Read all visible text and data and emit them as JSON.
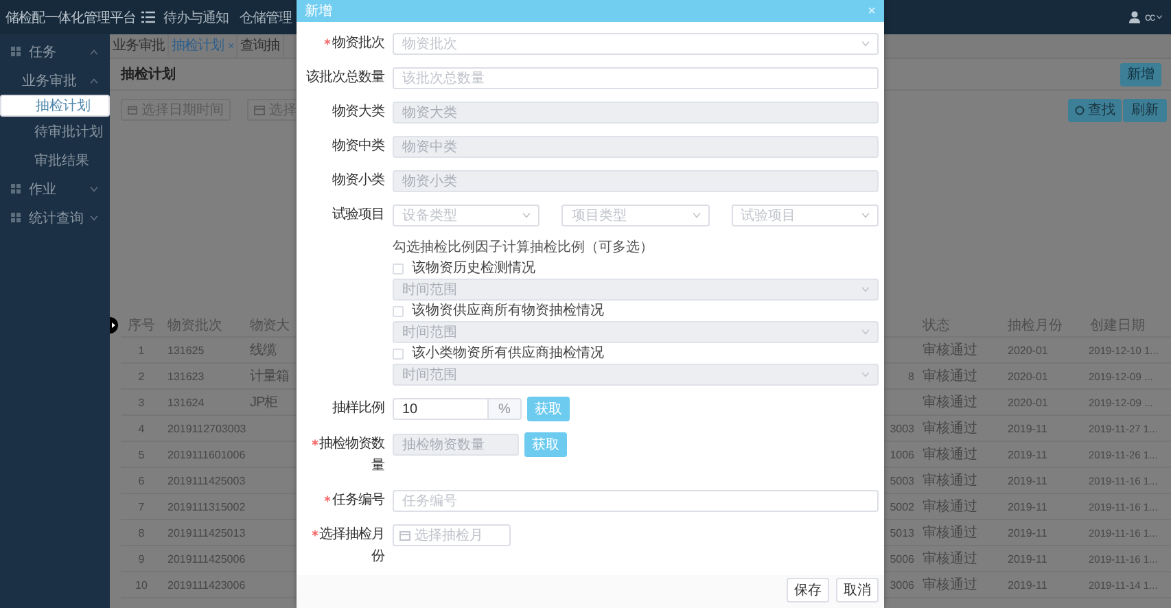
{
  "top_bar": {
    "title": "储检配一体化管理平台",
    "menu": [
      "待办与通知",
      "仓储管理"
    ],
    "user": "cc"
  },
  "sidebar": {
    "items": [
      {
        "label": "任务",
        "expanded": true,
        "children": [
          {
            "label": "业务审批",
            "expanded": true,
            "children": [
              {
                "label": "抽检计划",
                "selected": true
              },
              {
                "label": "待审批计划",
                "selected": false
              },
              {
                "label": "审批结果",
                "selected": false
              }
            ]
          }
        ]
      },
      {
        "label": "作业",
        "expanded": false
      },
      {
        "label": "统计查询",
        "expanded": false
      }
    ]
  },
  "tabs": [
    {
      "label": "业务审批",
      "selected": false
    },
    {
      "label": "抽检计划",
      "selected": true,
      "close": "×"
    },
    {
      "label": "查询抽",
      "selected": false
    }
  ],
  "page": {
    "title": "抽检计划",
    "date_fields": [
      {
        "placeholder": "选择日期时间"
      },
      {
        "placeholder": "选择"
      }
    ],
    "add_button": "新增",
    "search_button": "查找",
    "refresh_button": "刷新"
  },
  "table": {
    "header": {
      "no": "序号",
      "batch": "物资批次",
      "category": "物资大",
      "status": "状态",
      "month": "抽检月份",
      "created": "创建日期"
    },
    "rows": [
      {
        "no": "1",
        "batch": "131625",
        "category": "线缆",
        "status": "审核通过",
        "month": "2020-01",
        "created": "2019-12-10 1..."
      },
      {
        "no": "2",
        "batch": "131623",
        "category": "计量箱",
        "column_4": "8",
        "status": "审核通过",
        "month": "2020-01",
        "created": "2019-12-09 ..."
      },
      {
        "no": "3",
        "batch": "131624",
        "category": "JP柜",
        "status": "审核通过",
        "month": "2020-01",
        "created": "2019-12-09 ..."
      },
      {
        "no": "4",
        "batch": "2019112703003",
        "column_4": "3003",
        "status": "审核通过",
        "month": "2019-11",
        "created": "2019-11-27 1..."
      },
      {
        "no": "5",
        "batch": "2019111601006",
        "column_4": "1006",
        "status": "审核通过",
        "month": "2019-11",
        "created": "2019-11-26 1..."
      },
      {
        "no": "6",
        "batch": "2019111425003",
        "column_4": "5003",
        "status": "审核通过",
        "month": "2019-11",
        "created": "2019-11-16 1..."
      },
      {
        "no": "7",
        "batch": "2019111315002",
        "column_4": "5002",
        "status": "审核通过",
        "month": "2019-11",
        "created": "2019-11-16 1..."
      },
      {
        "no": "8",
        "batch": "2019111425013",
        "column_4": "5013",
        "status": "审核通过",
        "month": "2019-11",
        "created": "2019-11-16 1..."
      },
      {
        "no": "9",
        "batch": "2019111425006",
        "column_4": "5006",
        "status": "审核通过",
        "month": "2019-11",
        "created": "2019-11-16 1..."
      },
      {
        "no": "10",
        "batch": "2019111423006",
        "column_4": "3006",
        "status": "审核通过",
        "month": "2019-11",
        "created": "2019-11-14 1..."
      }
    ]
  },
  "modal": {
    "title": "新增",
    "close": "×",
    "fields": [
      {
        "kind": "select",
        "label": "物资批次",
        "required": true,
        "placeholder": "物资批次",
        "disabled": false
      },
      {
        "kind": "input",
        "label": "该批次总数量",
        "required": false,
        "placeholder": "该批次总数量",
        "disabled": false
      },
      {
        "kind": "input",
        "label": "物资大类",
        "required": false,
        "placeholder": "物资大类",
        "disabled": true
      },
      {
        "kind": "input",
        "label": "物资中类",
        "required": false,
        "placeholder": "物资中类",
        "disabled": true
      },
      {
        "kind": "input",
        "label": "物资小类",
        "required": false,
        "placeholder": "物资小类",
        "disabled": true
      },
      {
        "kind": "selects",
        "label": "试验项目",
        "required": false,
        "selects": [
          {
            "placeholder": "设备类型",
            "disabled": false
          },
          {
            "placeholder": "项目类型",
            "disabled": false
          },
          {
            "placeholder": "试验项目",
            "disabled": false
          }
        ]
      },
      {
        "kind": "factors",
        "hint": "勾选抽检比例因子计算抽检比例（可多选）",
        "options": [
          {
            "label": "该物资历史检测情况",
            "checked": false,
            "range": {
              "placeholder": "时间范围",
              "disabled": true
            }
          },
          {
            "label": "该物资供应商所有物资抽检情况",
            "checked": false,
            "range": {
              "placeholder": "时间范围",
              "disabled": true
            }
          },
          {
            "label": "该小类物资所有供应商抽检情况",
            "checked": false,
            "range": {
              "placeholder": "时间范围",
              "disabled": true
            }
          }
        ]
      },
      {
        "kind": "percent",
        "label": "抽样比例",
        "required": false,
        "value": "10",
        "suffix": "%",
        "button": "获取",
        "disabled": false
      },
      {
        "kind": "fetch",
        "label": "抽检物资数量",
        "required": true,
        "placeholder": "抽检物资数量",
        "button": "获取",
        "disabled": true
      },
      {
        "kind": "input",
        "label": "任务编号",
        "required": true,
        "placeholder": "任务编号",
        "disabled": false
      },
      {
        "kind": "month",
        "label": "选择抽检月份",
        "required": true,
        "placeholder": "选择抽检月"
      }
    ],
    "buttons": [
      "保存",
      "取消"
    ]
  }
}
